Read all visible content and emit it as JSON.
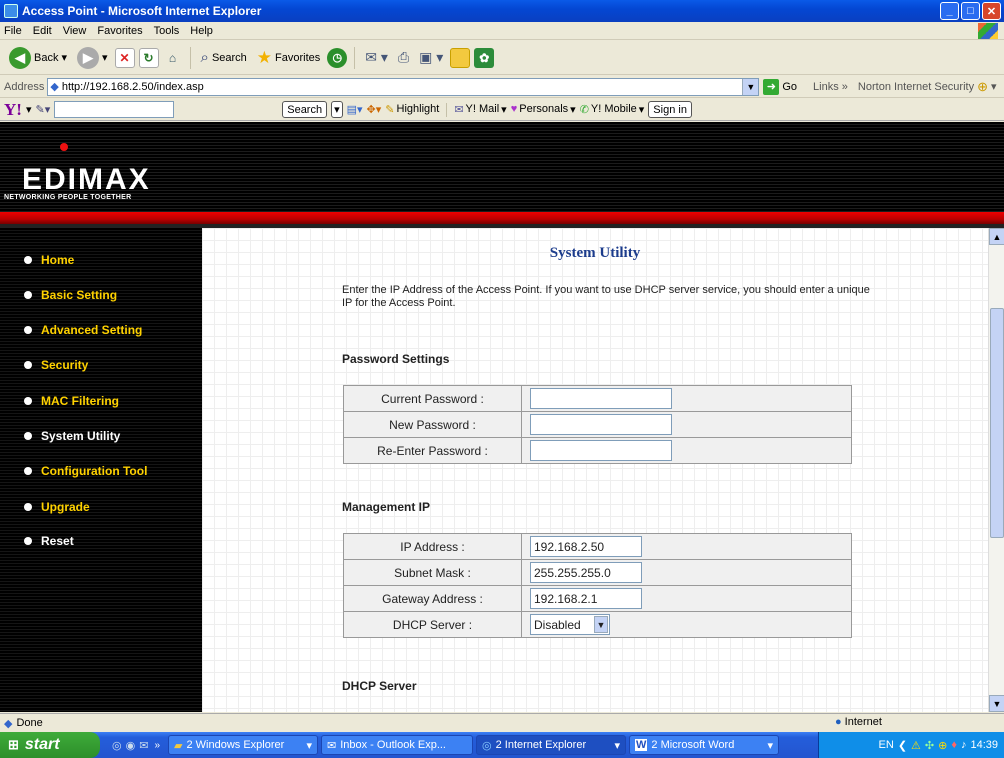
{
  "window": {
    "title": "Access Point - Microsoft Internet Explorer"
  },
  "menu": [
    "File",
    "Edit",
    "View",
    "Favorites",
    "Tools",
    "Help"
  ],
  "toolbar": {
    "back": "Back",
    "search": "Search",
    "favorites": "Favorites"
  },
  "address": {
    "label": "Address",
    "url": "http://192.168.2.50/index.asp",
    "go": "Go",
    "links": "Links",
    "norton": "Norton Internet Security"
  },
  "yahoo_bar": {
    "search": "Search",
    "highlight": "Highlight",
    "mail": "Y! Mail",
    "personals": "Personals",
    "mobile": "Y! Mobile",
    "signin": "Sign in"
  },
  "brand": {
    "logo": "EDIMAX",
    "tagline": "NETWORKING PEOPLE TOGETHER"
  },
  "nav": [
    {
      "label": "Home"
    },
    {
      "label": "Basic Setting"
    },
    {
      "label": "Advanced Setting"
    },
    {
      "label": "Security"
    },
    {
      "label": "MAC Filtering"
    },
    {
      "label": "System Utility"
    },
    {
      "label": "Configuration Tool"
    },
    {
      "label": "Upgrade"
    },
    {
      "label": "Reset"
    }
  ],
  "main": {
    "title": "System Utility",
    "description": "Enter the IP Address of the Access Point. If you want to use DHCP server service, you should enter a unique IP for the Access Point.",
    "password_section": "Password Settings",
    "password_rows": [
      {
        "label": "Current Password :",
        "value": ""
      },
      {
        "label": "New Password :",
        "value": ""
      },
      {
        "label": "Re-Enter Password :",
        "value": ""
      }
    ],
    "mgmt_section": "Management IP",
    "mgmt_rows": [
      {
        "label": "IP Address :",
        "value": "192.168.2.50"
      },
      {
        "label": "Subnet Mask :",
        "value": "255.255.255.0"
      },
      {
        "label": "Gateway Address :",
        "value": "192.168.2.1"
      },
      {
        "label": "DHCP Server :",
        "value": "Disabled"
      }
    ],
    "dhcp_section": "DHCP Server"
  },
  "status": {
    "text": "Done",
    "zone": "Internet"
  },
  "taskbar": {
    "start": "start",
    "items": [
      "2 Windows Explorer",
      "Inbox - Outlook Exp...",
      "2 Internet Explorer",
      "2 Microsoft Word"
    ],
    "lang": "EN",
    "clock": "14:39"
  },
  "colors": {
    "accent_yellow": "#ffd200",
    "title_blue": "#1c3c8c",
    "header_red": "#e00000"
  }
}
